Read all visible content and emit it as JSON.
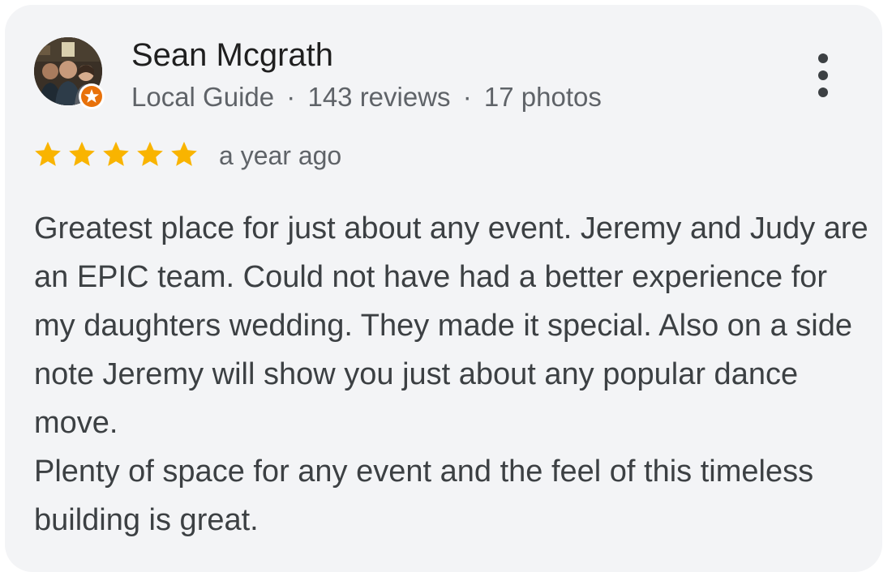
{
  "reviewer": {
    "name": "Sean Mcgrath",
    "role": "Local Guide",
    "separator": "·",
    "reviews_count": "143 reviews",
    "photos_count": "17 photos",
    "avatar_icon": "profile-photo",
    "badge_icon": "local-guide-star-badge"
  },
  "rating": {
    "stars": 5,
    "max_stars": 5,
    "star_color": "#f9b400",
    "time_ago": "a year ago"
  },
  "review": {
    "paragraph1": "Greatest place for just about any event. Jeremy and Judy are an EPIC team. Could not have had a better experience for my daughters wedding. They made it special. Also on a side note Jeremy will show you just about any popular dance move.",
    "paragraph2": "Plenty of space for any event and the feel of this timeless building is great."
  },
  "menu": {
    "icon": "more-vert-icon"
  },
  "colors": {
    "card_background": "#f3f4f6",
    "badge_orange": "#e8710a",
    "text_primary": "#1f1f1f",
    "text_secondary": "#5f6368"
  }
}
